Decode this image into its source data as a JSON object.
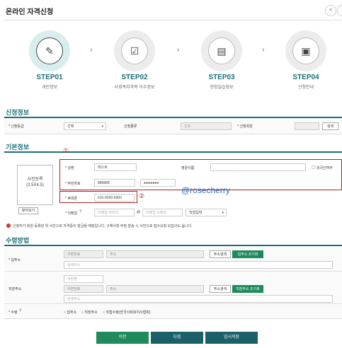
{
  "page": {
    "title": "온라인 자격신청"
  },
  "toolbar": {
    "share_icon": "share-icon",
    "print_icon": "print-icon"
  },
  "steps": [
    {
      "label": "STEP",
      "num": "01",
      "sub": "개인정보",
      "icon": "form-edit-icon",
      "active": true
    },
    {
      "label": "STEP",
      "num": "02",
      "sub": "사회복지과목 이수정보",
      "icon": "clipboard-check-icon",
      "active": false
    },
    {
      "label": "STEP",
      "num": "03",
      "sub": "현장실습정보",
      "icon": "document-list-icon",
      "active": false
    },
    {
      "label": "STEP",
      "num": "04",
      "sub": "신청안내",
      "icon": "bag-icon",
      "active": false
    }
  ],
  "apply": {
    "section_title": "신청정보",
    "grade_label": "* 신청등급",
    "grade_value": "선택",
    "type_label": "신청종류",
    "type_value": "신규",
    "org_label": "* 신청회원",
    "org_value": "",
    "search_button": "검색"
  },
  "basic": {
    "section_title": "기본정보",
    "marker1": "①",
    "marker2": "②",
    "photo_line1": "사진등록",
    "photo_line2": "(3.5X4.5)",
    "photo_button": "찾아보기",
    "name_label": "* 성명",
    "name_value": "테스트",
    "eng_name_label": "영문이름",
    "eng_name_value": "",
    "foreign_label": "외국인여부",
    "ssn_label": "* 주민번호",
    "ssn_front": "888888",
    "ssn_dash": "-",
    "ssn_back": "●●●●●●●",
    "phone_label": "* 휴대폰",
    "phone_value": "010-0000-0000",
    "email_label": "* 이메일",
    "email_id_placeholder": "이메일 아이디",
    "email_at": "@",
    "email_domain_placeholder": "이메일 도메인",
    "email_select": "직접입력",
    "watermark": "@rosecherry"
  },
  "notice": {
    "text": "신청자가 회원 등록된 위 사진으로 자격증이 발급될 예정입니다. 구체사항 부정 발송 시 사전으로 접수요청 모집이도 옵니다."
  },
  "receive": {
    "section_title": "수령방법",
    "home_label": "* 집주소",
    "home_zip_placeholder": "우편번호",
    "home_addr_placeholder": "주소",
    "home_detail_placeholder": "상세주소",
    "home_search_btn": "주소검색",
    "home_copy_btn": "집주소 조기화",
    "work_label": "직장주소",
    "work_name_placeholder": "직장명",
    "work_zip_placeholder": "우편번호",
    "work_addr_placeholder": "주소",
    "work_detail_placeholder": "상세주소",
    "work_search_btn": "주소검색",
    "work_copy_btn": "직장주소 조기화",
    "method_label": "* 수령",
    "method_options": [
      "집주소",
      "직장주소",
      "직접수령(한국사회복지사협회)"
    ]
  },
  "footer": {
    "prev_button": "이전",
    "next_button": "다음",
    "save_button": "임시저장"
  }
}
